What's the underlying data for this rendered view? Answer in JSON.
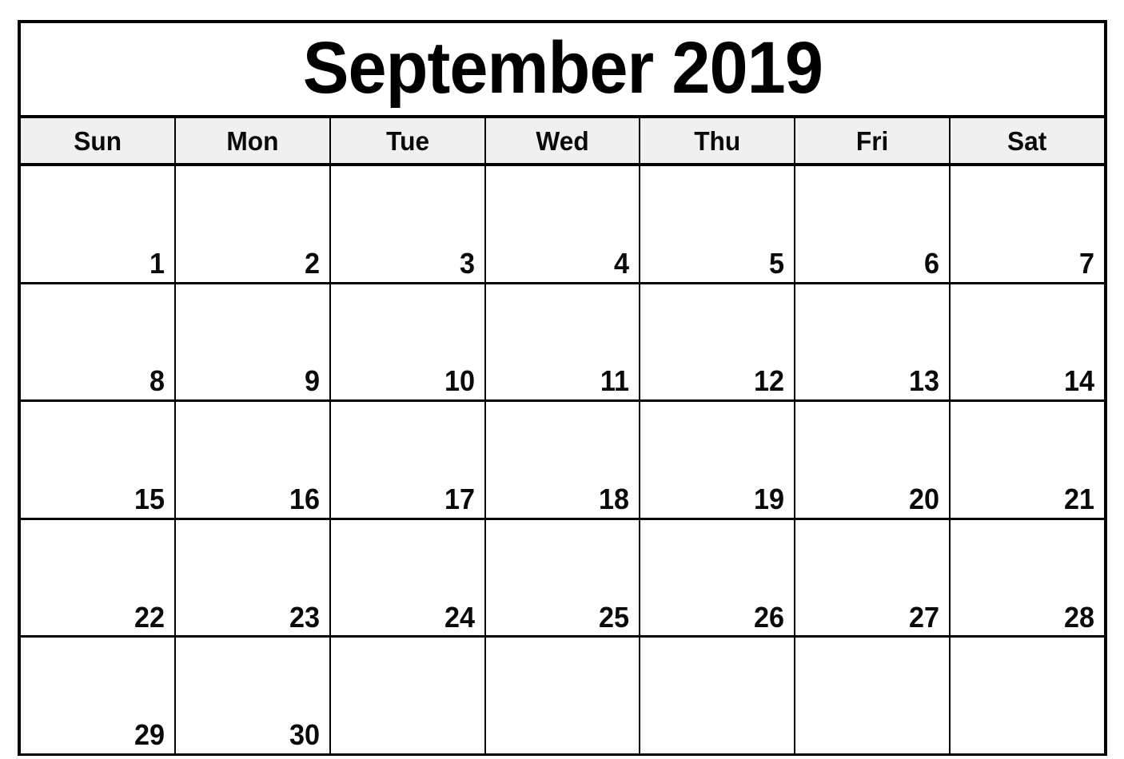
{
  "calendar": {
    "title": "September 2019",
    "month": "September",
    "year": "2019",
    "weekday_headers": [
      {
        "label": "Sun"
      },
      {
        "label": "Mon"
      },
      {
        "label": "Tue"
      },
      {
        "label": "Wed"
      },
      {
        "label": "Thu"
      },
      {
        "label": "Fri"
      },
      {
        "label": "Sat"
      }
    ],
    "weeks": [
      {
        "days": [
          {
            "number": "1"
          },
          {
            "number": "2"
          },
          {
            "number": "3"
          },
          {
            "number": "4"
          },
          {
            "number": "5"
          },
          {
            "number": "6"
          },
          {
            "number": "7"
          }
        ]
      },
      {
        "days": [
          {
            "number": "8"
          },
          {
            "number": "9"
          },
          {
            "number": "10"
          },
          {
            "number": "11"
          },
          {
            "number": "12"
          },
          {
            "number": "13"
          },
          {
            "number": "14"
          }
        ]
      },
      {
        "days": [
          {
            "number": "15"
          },
          {
            "number": "16"
          },
          {
            "number": "17"
          },
          {
            "number": "18"
          },
          {
            "number": "19"
          },
          {
            "number": "20"
          },
          {
            "number": "21"
          }
        ]
      },
      {
        "days": [
          {
            "number": "22"
          },
          {
            "number": "23"
          },
          {
            "number": "24"
          },
          {
            "number": "25"
          },
          {
            "number": "26"
          },
          {
            "number": "27"
          },
          {
            "number": "28"
          }
        ]
      },
      {
        "days": [
          {
            "number": "29"
          },
          {
            "number": "30"
          },
          {
            "number": ""
          },
          {
            "number": ""
          },
          {
            "number": ""
          },
          {
            "number": ""
          },
          {
            "number": ""
          }
        ]
      }
    ],
    "colors": {
      "border": "#000000",
      "header_background": "#f0f0f0",
      "cell_background": "#ffffff",
      "text": "#0a0a0a"
    }
  }
}
